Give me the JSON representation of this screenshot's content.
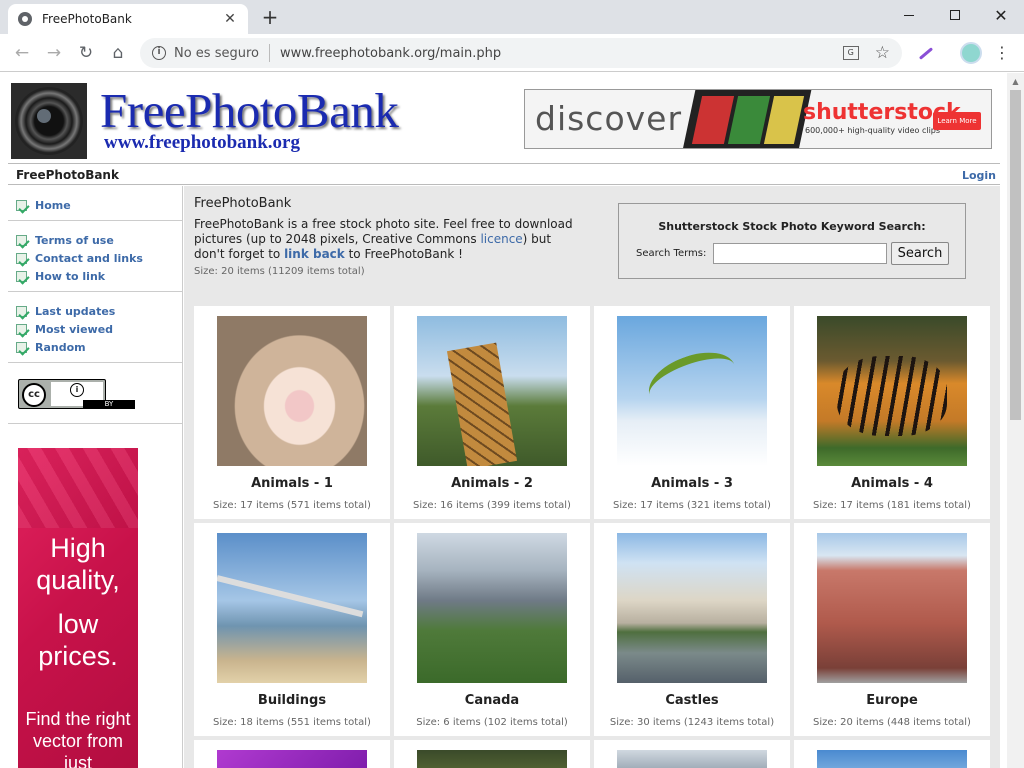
{
  "browser": {
    "tab_title": "FreePhotoBank",
    "tab_close": "✕",
    "new_tab": "+",
    "security_label": "No es seguro",
    "url": "www.freephotobank.org/main.php",
    "icons": [
      "back-arrow-icon",
      "forward-arrow-icon",
      "reload-icon",
      "home-icon",
      "info-icon",
      "translate-icon",
      "star-icon",
      "extension-icon",
      "profile-icon",
      "menu-icon"
    ]
  },
  "header": {
    "logo_text": "FreePhotoBank",
    "logo_url": "www.freephotobank.org",
    "banner": {
      "discover": "discover",
      "brand": "shutterstock",
      "tagline": "600,000+ high-quality video clips",
      "cta": "Learn More"
    }
  },
  "sitebar": {
    "brand": "FreePhotoBank",
    "login": "Login"
  },
  "sidebar": {
    "groups": [
      [
        {
          "label": "Home"
        }
      ],
      [
        {
          "label": "Terms of use"
        },
        {
          "label": "Contact and links"
        },
        {
          "label": "How to link"
        }
      ],
      [
        {
          "label": "Last updates"
        },
        {
          "label": "Most viewed"
        },
        {
          "label": "Random"
        }
      ]
    ],
    "cc_badge": {
      "cc": "cc",
      "person": "i",
      "by": "BY"
    },
    "ad": {
      "line1": "High quality,",
      "line2": "low prices.",
      "line3": "Find the right vector from just"
    }
  },
  "main": {
    "title": "FreePhotoBank",
    "desc_part1": "FreePhotoBank is a free stock photo site. Feel free to download pictures (up to 2048 pixels, Creative Commons ",
    "desc_link1": "licence",
    "desc_part2": ") but don't forget to ",
    "desc_link2": "link back",
    "desc_part3": " to FreePhotoBank !",
    "size": "Size: 20 items (11209 items total)",
    "search": {
      "title": "Shutterstock Stock Photo Keyword Search:",
      "terms_label": "Search Terms:",
      "value": "",
      "button": "Search"
    },
    "categories": [
      {
        "name": "Animals - 1",
        "count": "Size: 17 items (571 items total)"
      },
      {
        "name": "Animals - 2",
        "count": "Size: 16 items (399 items total)"
      },
      {
        "name": "Animals - 3",
        "count": "Size: 17 items (321 items total)"
      },
      {
        "name": "Animals - 4",
        "count": "Size: 17 items (181 items total)"
      },
      {
        "name": "Buildings",
        "count": "Size: 18 items (551 items total)"
      },
      {
        "name": "Canada",
        "count": "Size: 6 items (102 items total)"
      },
      {
        "name": "Castles",
        "count": "Size: 30 items (1243 items total)"
      },
      {
        "name": "Europe",
        "count": "Size: 20 items (448 items total)"
      }
    ]
  },
  "colors": {
    "link": "#3d6aa8",
    "logo": "#1b2bb0",
    "main_bg": "#e8e8e8",
    "ad_pink": "#e4235f"
  }
}
